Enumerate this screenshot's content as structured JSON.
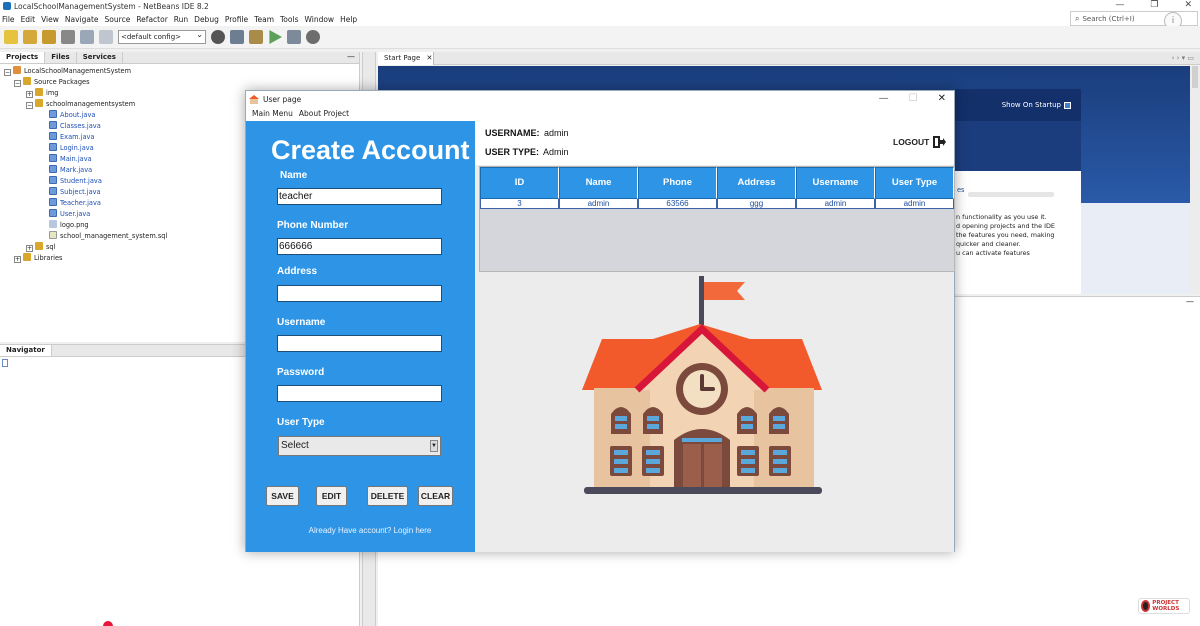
{
  "ide": {
    "title": "LocalSchoolManagementSystem - NetBeans IDE 8.2",
    "menu": [
      "File",
      "Edit",
      "View",
      "Navigate",
      "Source",
      "Refactor",
      "Run",
      "Debug",
      "Profile",
      "Team",
      "Tools",
      "Window",
      "Help"
    ],
    "search_placeholder": "Search (Ctrl+I)",
    "config": "<default config>",
    "window_controls": [
      "—",
      "❐",
      "✕"
    ]
  },
  "projects_panel": {
    "tabs": [
      "Projects",
      "Files",
      "Services"
    ],
    "tree": [
      {
        "label": "LocalSchoolManagementSystem",
        "type": "project"
      },
      {
        "label": "Source Packages",
        "type": "folder"
      },
      {
        "label": "img",
        "type": "package"
      },
      {
        "label": "schoolmanagementsystem",
        "type": "package"
      },
      {
        "label": "About.java",
        "type": "java"
      },
      {
        "label": "Classes.java",
        "type": "java"
      },
      {
        "label": "Exam.java",
        "type": "java"
      },
      {
        "label": "Login.java",
        "type": "java"
      },
      {
        "label": "Main.java",
        "type": "java"
      },
      {
        "label": "Mark.java",
        "type": "java"
      },
      {
        "label": "Student.java",
        "type": "java"
      },
      {
        "label": "Subject.java",
        "type": "java"
      },
      {
        "label": "Teacher.java",
        "type": "java"
      },
      {
        "label": "User.java",
        "type": "java"
      },
      {
        "label": "logo.png",
        "type": "image"
      },
      {
        "label": "school_management_system.sql",
        "type": "sql"
      },
      {
        "label": "sql",
        "type": "package"
      },
      {
        "label": "Libraries",
        "type": "folder"
      }
    ]
  },
  "navigator_panel": {
    "title": "Navigator"
  },
  "editor": {
    "tab_label": "Start Page",
    "show_on_startup": "Show On Startup",
    "partial_link": "es",
    "partial_text": "n functionality as you use it.\nd opening projects and the IDE\nthe features you need, making\nquicker and cleaner.\nu can activate features"
  },
  "user_frame": {
    "title": "User page",
    "menu": [
      "Main Menu",
      "About Project"
    ],
    "form": {
      "title": "Create Account",
      "labels": {
        "name": "Name",
        "phone": "Phone Number",
        "address": "Address",
        "username": "Username",
        "password": "Password",
        "user_type": "User Type"
      },
      "values": {
        "name": "teacher",
        "phone": "666666",
        "address": "",
        "username": "",
        "password": ""
      },
      "user_type_selected": "Select",
      "buttons": {
        "save": "SAVE",
        "edit": "EDIT",
        "delete": "DELETE",
        "clear": "CLEAR"
      },
      "login_link": "Already Have account? Login here"
    },
    "header": {
      "username_label": "USERNAME:",
      "username_value": "admin",
      "usertype_label": "USER TYPE:",
      "usertype_value": "Admin",
      "logout_label": "LOGOUT"
    },
    "table": {
      "columns": [
        "ID",
        "Name",
        "Phone",
        "Address",
        "Username",
        "User Type"
      ],
      "rows": [
        [
          "3",
          "admin",
          "63566",
          "ggg",
          "admin",
          "admin"
        ]
      ]
    }
  },
  "watermark": {
    "text": "PROJECT WORLDS"
  },
  "colors": {
    "form_blue": "#2e95e6",
    "table_header": "#2e95e6",
    "roof": "#f25a2c",
    "flag": "#f26a3c",
    "wall": "#e7c3a0"
  }
}
